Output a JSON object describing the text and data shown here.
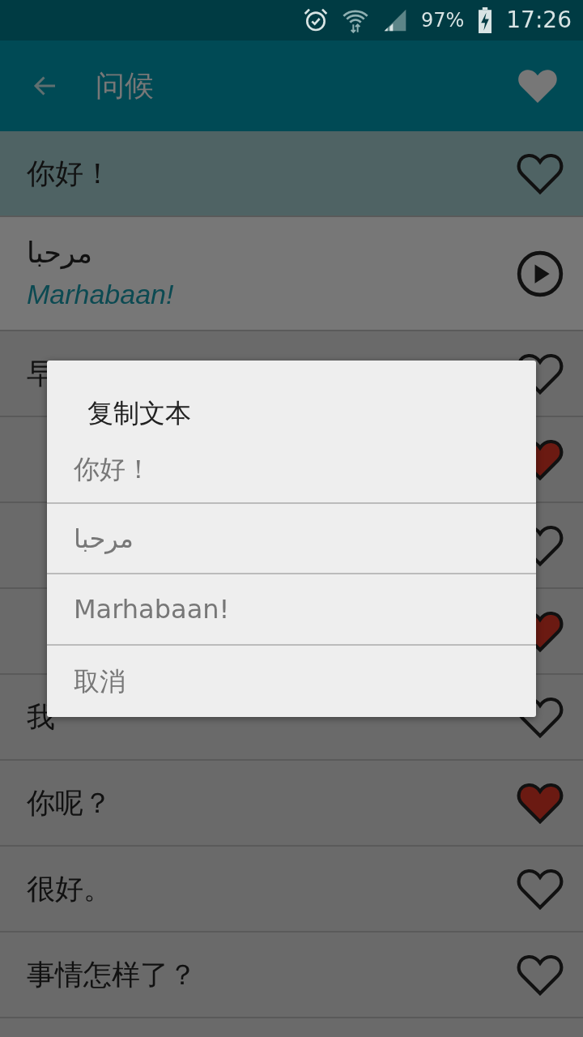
{
  "status_bar": {
    "battery": "97%",
    "time": "17:26"
  },
  "app_bar": {
    "title": "问候"
  },
  "rows": [
    {
      "kind": "phrase",
      "text": "你好！",
      "selected": true,
      "favorite": false
    },
    {
      "kind": "translation",
      "text": "مرحبا",
      "transliteration": "Marhabaan!",
      "selected": false
    },
    {
      "kind": "phrase",
      "text": "早",
      "selected": false,
      "favorite": false
    },
    {
      "kind": "phrase",
      "selected": false,
      "favorite": true
    },
    {
      "kind": "phrase",
      "selected": false,
      "favorite": false
    },
    {
      "kind": "phrase",
      "selected": false,
      "favorite": true
    },
    {
      "kind": "phrase",
      "text": "我",
      "selected": false,
      "favorite": false
    },
    {
      "kind": "phrase",
      "text": "你呢？",
      "selected": false,
      "favorite": true
    },
    {
      "kind": "phrase",
      "text": "很好。",
      "selected": false,
      "favorite": false
    },
    {
      "kind": "phrase",
      "text": "事情怎样了？",
      "selected": false,
      "favorite": false
    }
  ],
  "dialog": {
    "title": "复制文本",
    "options": [
      "你好！",
      "مرحبا",
      "Marhabaan!",
      "取消"
    ]
  }
}
